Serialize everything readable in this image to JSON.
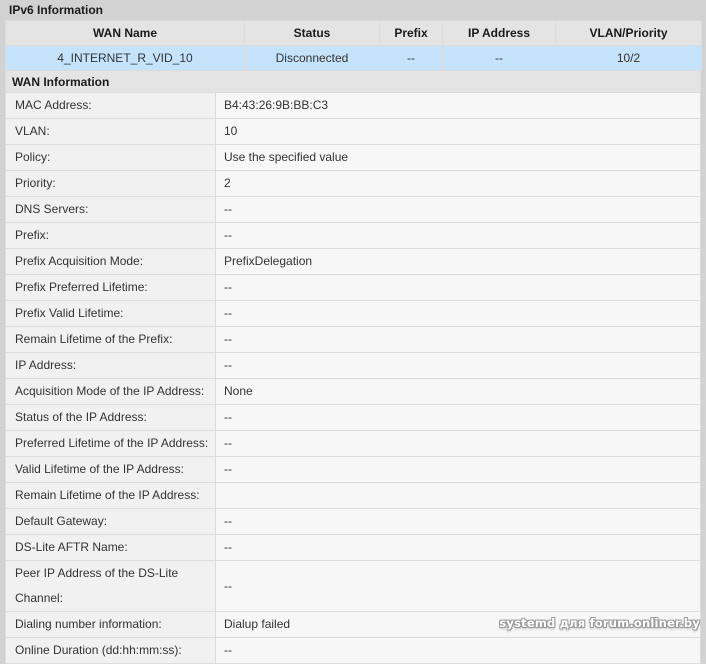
{
  "section": {
    "title": "IPv6 Information"
  },
  "summary_table": {
    "columns": [
      "WAN Name",
      "Status",
      "Prefix",
      "IP Address",
      "VLAN/Priority"
    ],
    "rows": [
      {
        "wan_name": "4_INTERNET_R_VID_10",
        "status": "Disconnected",
        "prefix": "--",
        "ip_address": "--",
        "vlan_priority": "10/2"
      }
    ]
  },
  "wan_information": {
    "header": "WAN Information",
    "rows": [
      {
        "label": "MAC Address:",
        "value": "B4:43:26:9B:BB:C3"
      },
      {
        "label": "VLAN:",
        "value": "10"
      },
      {
        "label": "Policy:",
        "value": "Use the specified value"
      },
      {
        "label": "Priority:",
        "value": "2"
      },
      {
        "label": "DNS Servers:",
        "value": "--"
      },
      {
        "label": "Prefix:",
        "value": "--"
      },
      {
        "label": "Prefix Acquisition Mode:",
        "value": "PrefixDelegation"
      },
      {
        "label": "Prefix Preferred Lifetime:",
        "value": "--"
      },
      {
        "label": "Prefix Valid Lifetime:",
        "value": "--"
      },
      {
        "label": "Remain Lifetime of the Prefix:",
        "value": "--"
      },
      {
        "label": "IP Address:",
        "value": "--"
      },
      {
        "label": "Acquisition Mode of the IP Address:",
        "value": "None"
      },
      {
        "label": "Status of the IP Address:",
        "value": "--"
      },
      {
        "label": "Preferred Lifetime of the IP Address:",
        "value": "--"
      },
      {
        "label": "Valid Lifetime of the IP Address:",
        "value": "--"
      },
      {
        "label": "Remain Lifetime of the IP Address:",
        "value": ""
      },
      {
        "label": "Default Gateway:",
        "value": "--"
      },
      {
        "label": "DS-Lite AFTR Name:",
        "value": "--"
      },
      {
        "label": "Peer IP Address of the DS-Lite Channel:",
        "value": "--",
        "tall": true
      },
      {
        "label": "Dialing number information:",
        "value": "Dialup failed"
      },
      {
        "label": "Online Duration (dd:hh:mm:ss):",
        "value": "--"
      }
    ]
  },
  "watermark": {
    "text": "systemd для forum.onliner.by"
  },
  "colors": {
    "page_background": "#d2d2d2",
    "header_row": "#e4e4e4",
    "selected_row": "#c5e3fb",
    "label_cell": "#f1f1f1",
    "value_cell": "#f7f7f7",
    "border": "#dcdcdc"
  }
}
